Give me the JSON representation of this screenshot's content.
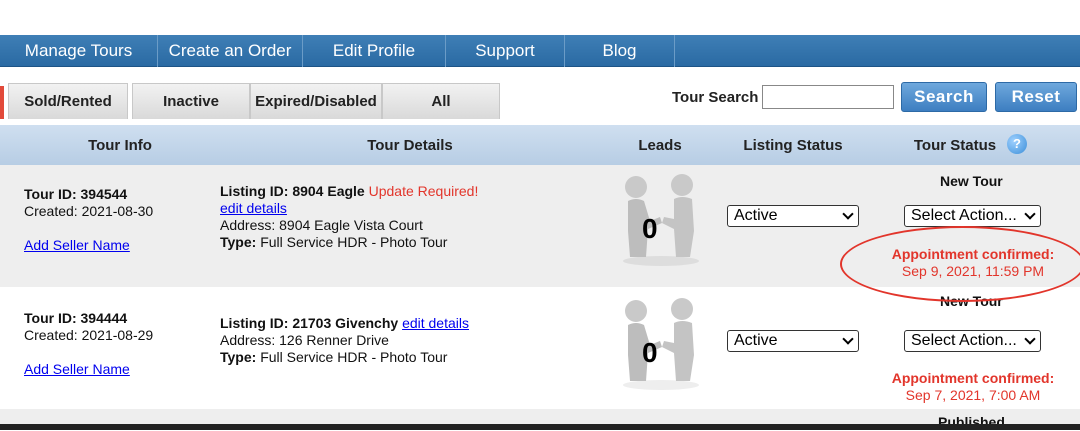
{
  "nav": {
    "items": [
      "Manage Tours",
      "Create an Order",
      "Edit Profile",
      "Support",
      "Blog"
    ]
  },
  "tabs": [
    "Sold/Rented",
    "Inactive",
    "Expired/Disabled",
    "All"
  ],
  "search": {
    "label": "Tour Search",
    "value": "",
    "search_button": "Search",
    "reset_button": "Reset"
  },
  "table": {
    "headers": [
      "Tour Info",
      "Tour Details",
      "Leads",
      "Listing Status",
      "Tour Status"
    ],
    "help_glyph": "?",
    "rows": [
      {
        "tour_id": "Tour ID: 394544",
        "created": "Created: 2021-08-30",
        "seller_link": "Add Seller Name",
        "listing": "Listing ID: 8904 Eagle",
        "warning": "Update Required!",
        "edit_link": "edit details",
        "address": "Address: 8904 Eagle Vista Court",
        "type_label": "Type:",
        "type_value": "Full Service HDR - Photo Tour",
        "leads": "0",
        "listing_status": "Active",
        "tour_status": "New Tour",
        "action": "Select Action...",
        "appt_title": "Appointment confirmed:",
        "appt_time": "Sep 9, 2021, 11:59 PM"
      },
      {
        "tour_id": "Tour ID: 394444",
        "created": "Created: 2021-08-29",
        "seller_link": "Add Seller Name",
        "listing": "Listing ID: 21703 Givenchy",
        "edit_link": "edit details",
        "address": "Address: 126 Renner Drive",
        "type_label": "Type:",
        "type_value": "Full Service HDR - Photo Tour",
        "leads": "0",
        "listing_status": "Active",
        "tour_status": "New Tour",
        "action": "Select Action...",
        "appt_title": "Appointment confirmed:",
        "appt_time": "Sep 7, 2021, 7:00 AM"
      }
    ],
    "partial_row": {
      "tour_status": "Published"
    }
  },
  "colors": {
    "nav": "#2a6aa3",
    "accent_red": "#e2352b",
    "link": "#0000ee"
  }
}
